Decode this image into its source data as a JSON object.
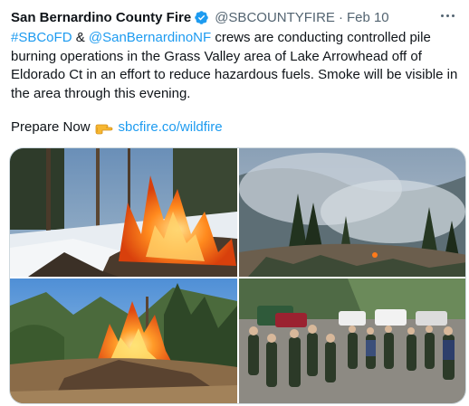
{
  "tweet": {
    "display_name": "San Bernardino County Fire",
    "handle": "@SBCOUNTYFIRE",
    "separator": "·",
    "date": "Feb 10",
    "body": {
      "mention1": "#SBCoFD",
      "amp": " & ",
      "mention2": "@SanBernardinoNF",
      "text": " crews are conducting controlled pile burning operations in the Grass Valley area of Lake Arrowhead off of Eldorado Ct in an effort to reduce hazardous fuels. Smoke will be visible in the area through this evening."
    },
    "cta": {
      "text": "Prepare Now",
      "link": "sbcfire.co/wildfire"
    },
    "icons": {
      "verified": "verified-badge-icon",
      "more": "more-options-icon",
      "hand": "pointing-hand-emoji"
    },
    "colors": {
      "link": "#1d9bf0",
      "verified": "#1d9bf0",
      "muted": "#536471"
    }
  },
  "media": {
    "photos": [
      {
        "subject": "pile burning with flames in snowy forest"
      },
      {
        "subject": "smoke rising over pine forested hillside"
      },
      {
        "subject": "large burning brush pile among trees"
      },
      {
        "subject": "fire crew briefing near trucks"
      }
    ]
  }
}
